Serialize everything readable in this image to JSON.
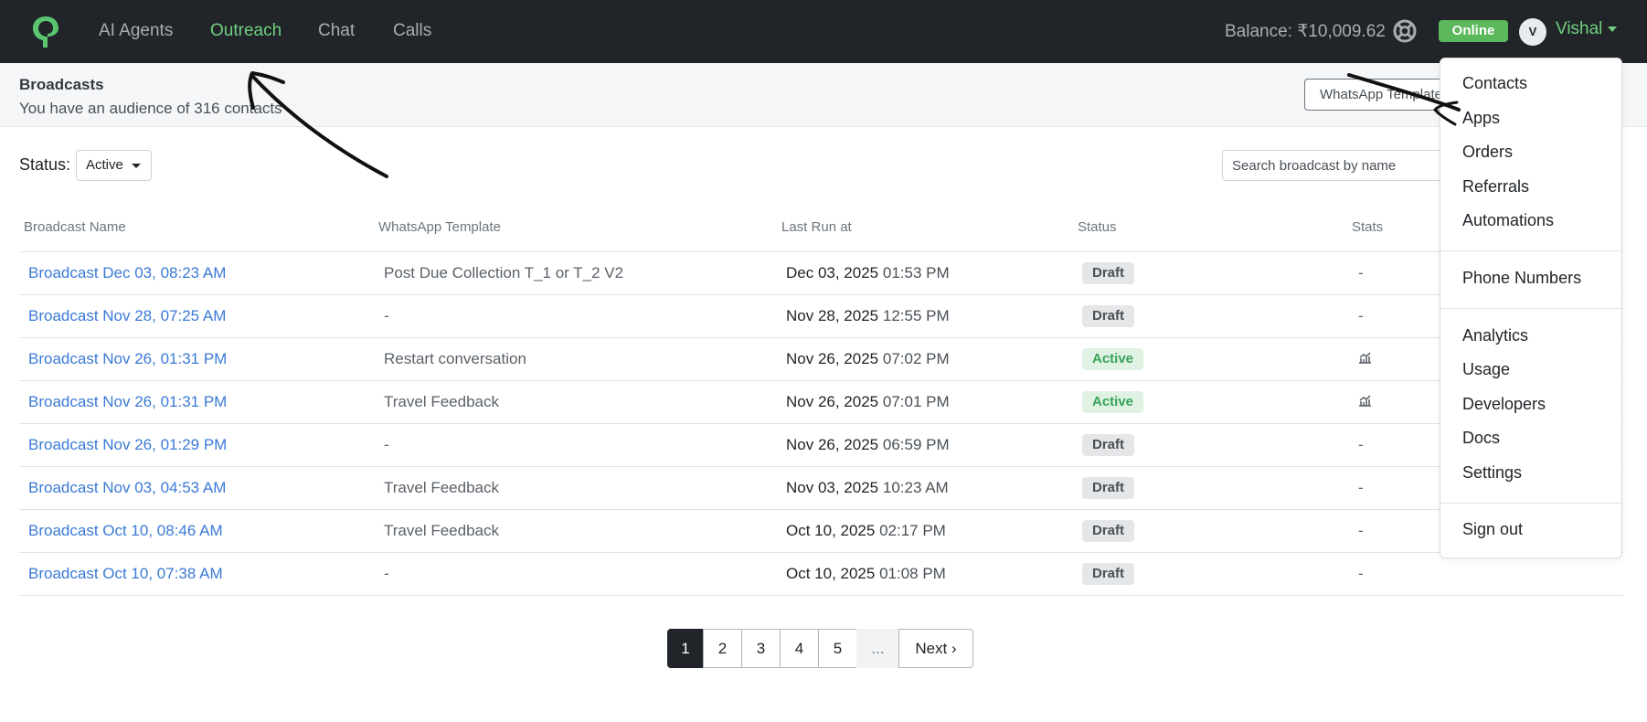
{
  "nav": {
    "items": [
      "AI Agents",
      "Outreach",
      "Chat",
      "Calls"
    ],
    "active": "Outreach",
    "balance": "Balance: ₹10,009.62",
    "status_badge": "Online",
    "avatar_initial": "V",
    "user_name": "Vishal"
  },
  "header": {
    "title": "Broadcasts",
    "subtitle": "You have an audience of 316 contacts",
    "template_button": "WhatsApp Templates"
  },
  "filters": {
    "status_label": "Status:",
    "status_value": "Active",
    "search_placeholder": "Search broadcast by name"
  },
  "table": {
    "columns": [
      "Broadcast Name",
      "WhatsApp Template",
      "Last Run at",
      "Status",
      "Stats"
    ],
    "rows": [
      {
        "name": "Broadcast Dec 03, 08:23 AM",
        "template": "Post Due Collection T_1 or T_2 V2",
        "date": "Dec 03, 2025",
        "time": "01:53 PM",
        "status": "Draft",
        "stats": "-"
      },
      {
        "name": "Broadcast Nov 28, 07:25 AM",
        "template": "-",
        "date": "Nov 28, 2025",
        "time": "12:55 PM",
        "status": "Draft",
        "stats": "-"
      },
      {
        "name": "Broadcast Nov 26, 01:31 PM",
        "template": "Restart conversation",
        "date": "Nov 26, 2025",
        "time": "07:02 PM",
        "status": "Active",
        "stats": "chart-icon"
      },
      {
        "name": "Broadcast Nov 26, 01:31 PM",
        "template": "Travel Feedback",
        "date": "Nov 26, 2025",
        "time": "07:01 PM",
        "status": "Active",
        "stats": "chart-icon"
      },
      {
        "name": "Broadcast Nov 26, 01:29 PM",
        "template": "-",
        "date": "Nov 26, 2025",
        "time": "06:59 PM",
        "status": "Draft",
        "stats": "-"
      },
      {
        "name": "Broadcast Nov 03, 04:53 AM",
        "template": "Travel Feedback",
        "date": "Nov 03, 2025",
        "time": "10:23 AM",
        "status": "Draft",
        "stats": "-"
      },
      {
        "name": "Broadcast Oct 10, 08:46 AM",
        "template": "Travel Feedback",
        "date": "Oct 10, 2025",
        "time": "02:17 PM",
        "status": "Draft",
        "stats": "-"
      },
      {
        "name": "Broadcast Oct 10, 07:38 AM",
        "template": "-",
        "date": "Oct 10, 2025",
        "time": "01:08 PM",
        "status": "Draft",
        "stats": "-"
      }
    ]
  },
  "pagination": {
    "pages": [
      "1",
      "2",
      "3",
      "4",
      "5"
    ],
    "current": "1",
    "ellipsis": "...",
    "next": "Next ›"
  },
  "dropdown": {
    "groups": [
      [
        "Contacts",
        "Apps",
        "Orders",
        "Referrals",
        "Automations"
      ],
      [
        "Phone Numbers"
      ],
      [
        "Analytics",
        "Usage",
        "Developers",
        "Docs",
        "Settings"
      ],
      [
        "Sign out"
      ]
    ]
  },
  "colors": {
    "nav_bg": "#212529",
    "accent_green": "#6fcf7f",
    "link_blue": "#3a7ad6",
    "online_green": "#5cb85c"
  }
}
